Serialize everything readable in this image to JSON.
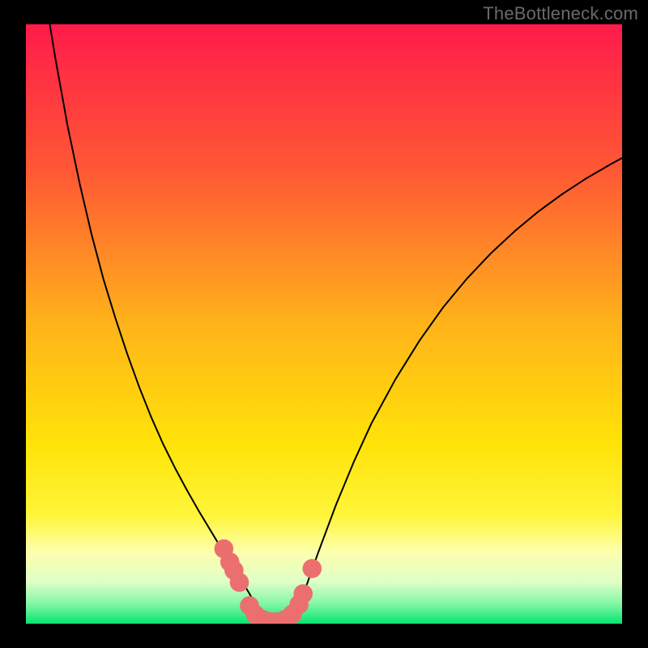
{
  "watermark": "TheBottleneck.com",
  "chart_data": {
    "type": "line",
    "title": "",
    "xlabel": "",
    "ylabel": "",
    "xlim": [
      0,
      100
    ],
    "ylim": [
      0,
      100
    ],
    "background_gradient": {
      "stops": [
        {
          "offset": 0.0,
          "color": "#ff1b4b"
        },
        {
          "offset": 0.25,
          "color": "#ff5a34"
        },
        {
          "offset": 0.5,
          "color": "#ffb31a"
        },
        {
          "offset": 0.7,
          "color": "#ffe308"
        },
        {
          "offset": 0.82,
          "color": "#fff53a"
        },
        {
          "offset": 0.88,
          "color": "#fdffad"
        },
        {
          "offset": 0.93,
          "color": "#dfffc7"
        },
        {
          "offset": 0.965,
          "color": "#88f7a8"
        },
        {
          "offset": 1.0,
          "color": "#06e56f"
        }
      ]
    },
    "series": [
      {
        "name": "left-branch",
        "x": [
          4,
          5,
          7,
          9,
          11,
          13,
          15,
          17,
          19,
          21,
          23,
          25,
          27,
          29,
          31,
          33,
          34.5,
          36,
          37.5,
          39,
          40
        ],
        "y": [
          100,
          94,
          83,
          73.5,
          65,
          57.5,
          51,
          45,
          39.5,
          34.5,
          30,
          26,
          22.3,
          18.8,
          15.5,
          12.2,
          9.9,
          7.5,
          5.0,
          2.3,
          0.3
        ],
        "style": "thin-black"
      },
      {
        "name": "right-branch",
        "x": [
          44,
          45,
          47,
          49,
          52,
          55,
          58,
          62,
          66,
          70,
          74,
          78,
          82,
          86,
          90,
          94,
          98,
          100
        ],
        "y": [
          0.3,
          2.0,
          6.2,
          11.8,
          19.8,
          27.0,
          33.5,
          40.8,
          47.2,
          52.8,
          57.6,
          61.8,
          65.5,
          68.8,
          71.7,
          74.3,
          76.6,
          77.7
        ],
        "style": "thin-black"
      }
    ],
    "markers": [
      {
        "name": "left-cluster",
        "color": "#ec6f6f",
        "radius_pct": 1.6,
        "points": [
          {
            "x": 33.2,
            "y": 12.5
          },
          {
            "x": 34.2,
            "y": 10.3
          },
          {
            "x": 34.9,
            "y": 8.9
          },
          {
            "x": 35.8,
            "y": 6.9
          }
        ]
      },
      {
        "name": "valley-band",
        "color": "#ec6f6f",
        "radius_pct": 1.6,
        "points": [
          {
            "x": 37.5,
            "y": 3.0
          },
          {
            "x": 38.5,
            "y": 1.5
          },
          {
            "x": 39.7,
            "y": 0.7
          },
          {
            "x": 41.0,
            "y": 0.35
          },
          {
            "x": 42.3,
            "y": 0.35
          },
          {
            "x": 43.5,
            "y": 0.7
          },
          {
            "x": 44.7,
            "y": 1.6
          },
          {
            "x": 45.8,
            "y": 3.2
          },
          {
            "x": 46.5,
            "y": 5.0
          }
        ]
      },
      {
        "name": "right-outlier",
        "color": "#ec6f6f",
        "radius_pct": 1.6,
        "points": [
          {
            "x": 48.0,
            "y": 9.2
          }
        ]
      }
    ]
  }
}
